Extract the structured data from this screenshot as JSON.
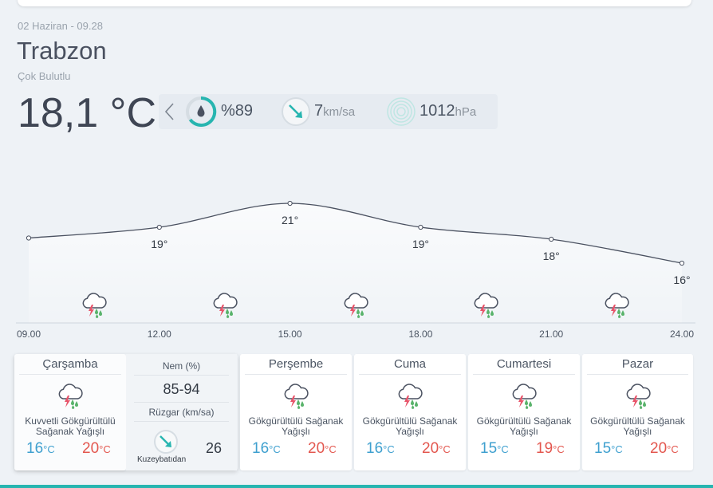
{
  "header": {
    "date": "02 Haziran - 09.28",
    "city": "Trabzon",
    "condition": "Çok Bulutlu",
    "temperature": "18,1 °C"
  },
  "metrics": {
    "humidity_value": "%89",
    "wind_value": "7",
    "wind_unit": "km/sa",
    "pressure_value": "1012",
    "pressure_unit": "hPa"
  },
  "chart_data": {
    "type": "line",
    "x": [
      "09.00",
      "12.00",
      "15.00",
      "18.00",
      "21.00",
      "24.00"
    ],
    "series": [
      {
        "values": [
          18.1,
          19,
          21,
          19,
          18,
          16
        ]
      }
    ],
    "point_labels": [
      "",
      "19°",
      "21°",
      "19°",
      "18°",
      "16°"
    ],
    "grid": false
  },
  "hourly_icons": [
    "thunderstorm-rain-icon",
    "thunderstorm-rain-icon",
    "thunderstorm-rain-icon",
    "thunderstorm-rain-icon",
    "thunderstorm-rain-icon"
  ],
  "colors": {
    "accent": "#27b5b0",
    "min_temp": "#3fa0cf",
    "max_temp": "#e3574f",
    "storm_bolt": "#e8546a",
    "rain_drop": "#59b36b"
  },
  "days": [
    {
      "name": "Çarşamba",
      "desc_line1": "Kuvvetli Gökgürültülü",
      "desc_line2": "Sağanak Yağışlı",
      "min": "16",
      "max": "20",
      "icon": "thunderstorm-rain-icon"
    },
    {
      "name": "Perşembe",
      "desc_line1": "Gökgürültülü Sağanak",
      "desc_line2": "Yağışlı",
      "min": "16",
      "max": "20",
      "icon": "thunderstorm-rain-icon"
    },
    {
      "name": "Cuma",
      "desc_line1": "Gökgürültülü Sağanak",
      "desc_line2": "Yağışlı",
      "min": "16",
      "max": "20",
      "icon": "thunderstorm-rain-icon"
    },
    {
      "name": "Cumartesi",
      "desc_line1": "Gökgürültülü Sağanak",
      "desc_line2": "Yağışlı",
      "min": "15",
      "max": "19",
      "icon": "thunderstorm-rain-icon"
    },
    {
      "name": "Pazar",
      "desc_line1": "Gökgürültülü Sağanak",
      "desc_line2": "Yağışlı",
      "min": "15",
      "max": "20",
      "icon": "thunderstorm-rain-icon"
    }
  ],
  "temp_unit": "°C",
  "detail": {
    "humidity_label": "Nem (%)",
    "humidity_value": "85-94",
    "wind_label": "Rüzgar (km/sa)",
    "wind_direction": "Kuzeybatıdan",
    "wind_value": "26"
  }
}
